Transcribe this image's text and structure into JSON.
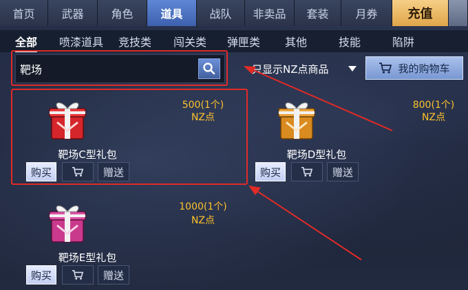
{
  "top_tabs": [
    {
      "label": "首页"
    },
    {
      "label": "武器"
    },
    {
      "label": "角色"
    },
    {
      "label": "道具"
    },
    {
      "label": "战队"
    },
    {
      "label": "非卖品"
    },
    {
      "label": "套装"
    },
    {
      "label": "月券"
    },
    {
      "label": "充值"
    }
  ],
  "sub_tabs": [
    {
      "label": "全部"
    },
    {
      "label": "喷漆道具"
    },
    {
      "label": "竞技类"
    },
    {
      "label": "闯关类"
    },
    {
      "label": "弹匣类"
    },
    {
      "label": "其他"
    },
    {
      "label": "技能"
    },
    {
      "label": "陷阱"
    }
  ],
  "search": {
    "value": "靶场",
    "icon": "search-icon"
  },
  "filter": {
    "label": "只显示NZ点商品"
  },
  "cart": {
    "label": "我的购物车",
    "icon": "shopping-cart-icon"
  },
  "items": [
    {
      "name": "靶场C型礼包",
      "price": "500(1个)",
      "currency": "NZ点",
      "color": "#d4262b",
      "buy_label": "购买",
      "gift_label": "赠送"
    },
    {
      "name": "靶场D型礼包",
      "price": "800(1个)",
      "currency": "NZ点",
      "color": "#d98b1f",
      "buy_label": "购买",
      "gift_label": "赠送"
    },
    {
      "name": "靶场E型礼包",
      "price": "1000(1个)",
      "currency": "NZ点",
      "color": "#c93a8d",
      "buy_label": "购买",
      "gift_label": "赠送"
    }
  ],
  "colors": {
    "accent_tab": "#4a70c0",
    "price": "#ffc22c",
    "highlight": "#e22b26"
  }
}
